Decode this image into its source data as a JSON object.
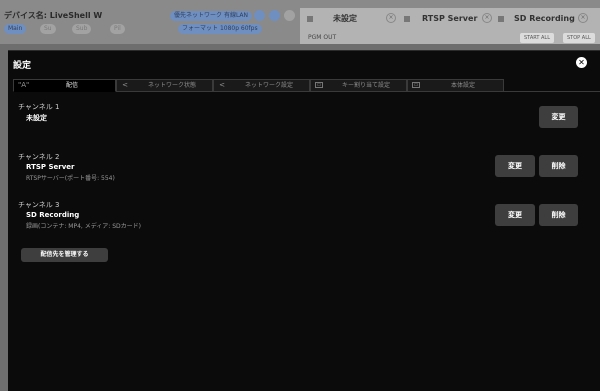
{
  "background": {
    "device_label": "デバイス名: LiveShell W",
    "pills": [
      "優先ネットワーク",
      "有線LAN",
      "Main",
      "Su",
      "Sub",
      "Pil"
    ],
    "format_label": "フォーマット",
    "format_value": "1080p 60fps",
    "tabs": [
      {
        "label": "未設定"
      },
      {
        "label": "RTSP Server"
      },
      {
        "label": "SD Recording"
      }
    ],
    "pgm_out": "PGM OUT",
    "start_all": "START ALL",
    "stop_all": "STOP ALL"
  },
  "dialog": {
    "title": "設定",
    "close_glyph": "✕",
    "tabs": [
      {
        "icon": "\"A\"",
        "label": "配信",
        "active": true
      },
      {
        "icon": "<",
        "label": "ネットワーク状態",
        "active": false
      },
      {
        "icon": "<",
        "label": "ネットワーク設定",
        "active": false
      },
      {
        "icon": "▭",
        "label": "キー割り当て設定",
        "active": false
      },
      {
        "icon": "▭",
        "label": "本体設定",
        "active": false
      }
    ],
    "channels": [
      {
        "header": "チャンネル 1",
        "name": "未設定",
        "detail": "",
        "edit_label": "変更",
        "delete_label": ""
      },
      {
        "header": "チャンネル 2",
        "name": "RTSP Server",
        "detail": "RTSPサーバー(ポート番号: 554)",
        "edit_label": "変更",
        "delete_label": "削除"
      },
      {
        "header": "チャンネル 3",
        "name": "SD Recording",
        "detail": "録画(コンテナ: MP4, メディア: SDカード)",
        "edit_label": "変更",
        "delete_label": "削除"
      }
    ],
    "manage_label": "配信先を管理する"
  }
}
